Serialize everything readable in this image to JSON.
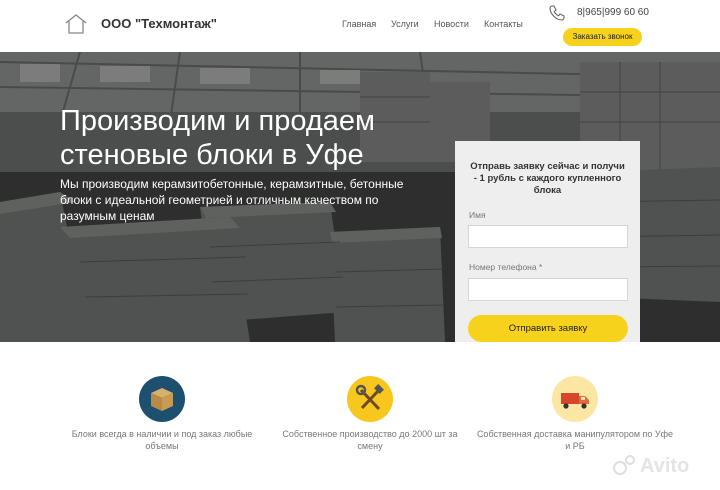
{
  "header": {
    "company": "ООО \"Техмонтаж\"",
    "nav": [
      "Главная",
      "Услуги",
      "Новости",
      "Контакты"
    ],
    "phone": "8|965|999 60 60",
    "callback_label": "Заказать звонок"
  },
  "hero": {
    "title": "Производим и продаем стеновые блоки в Уфе",
    "subtitle": "Мы производим керамзитобетонные, керамзитные, бетонные блоки с идеальной геометрией и отличным качеством по разумным ценам"
  },
  "form": {
    "title": "Отправь заявку сейчас и получи - 1 рубль с каждого купленного блока",
    "name_label": "Имя",
    "name_value": "",
    "phone_label": "Номер телефона *",
    "phone_value": "",
    "submit_label": "Отправить заявку"
  },
  "features": [
    {
      "icon": "box-icon",
      "text": "Блоки всегда в наличии и под заказ любые объемы",
      "color": "#1d4f6f"
    },
    {
      "icon": "tools-icon",
      "text": "Собственное производство до 2000 шт за смену",
      "color": "#f7c71d"
    },
    {
      "icon": "truck-icon",
      "text": "Собственная доставка манипулятором по Уфе и РБ",
      "color": "#fbe6a3"
    }
  ],
  "watermark": "Avito",
  "colors": {
    "accent": "#f7d21d",
    "text": "#333333"
  }
}
